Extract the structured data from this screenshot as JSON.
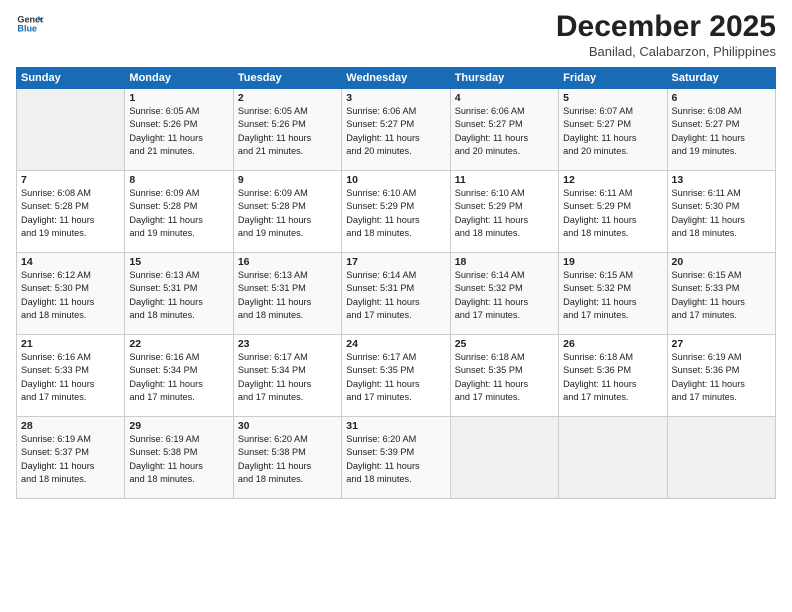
{
  "header": {
    "logo_line1": "General",
    "logo_line2": "Blue",
    "month": "December 2025",
    "location": "Banilad, Calabarzon, Philippines"
  },
  "days_of_week": [
    "Sunday",
    "Monday",
    "Tuesday",
    "Wednesday",
    "Thursday",
    "Friday",
    "Saturday"
  ],
  "weeks": [
    [
      {
        "day": "",
        "info": ""
      },
      {
        "day": "1",
        "info": "Sunrise: 6:05 AM\nSunset: 5:26 PM\nDaylight: 11 hours\nand 21 minutes."
      },
      {
        "day": "2",
        "info": "Sunrise: 6:05 AM\nSunset: 5:26 PM\nDaylight: 11 hours\nand 21 minutes."
      },
      {
        "day": "3",
        "info": "Sunrise: 6:06 AM\nSunset: 5:27 PM\nDaylight: 11 hours\nand 20 minutes."
      },
      {
        "day": "4",
        "info": "Sunrise: 6:06 AM\nSunset: 5:27 PM\nDaylight: 11 hours\nand 20 minutes."
      },
      {
        "day": "5",
        "info": "Sunrise: 6:07 AM\nSunset: 5:27 PM\nDaylight: 11 hours\nand 20 minutes."
      },
      {
        "day": "6",
        "info": "Sunrise: 6:08 AM\nSunset: 5:27 PM\nDaylight: 11 hours\nand 19 minutes."
      }
    ],
    [
      {
        "day": "7",
        "info": "Sunrise: 6:08 AM\nSunset: 5:28 PM\nDaylight: 11 hours\nand 19 minutes."
      },
      {
        "day": "8",
        "info": "Sunrise: 6:09 AM\nSunset: 5:28 PM\nDaylight: 11 hours\nand 19 minutes."
      },
      {
        "day": "9",
        "info": "Sunrise: 6:09 AM\nSunset: 5:28 PM\nDaylight: 11 hours\nand 19 minutes."
      },
      {
        "day": "10",
        "info": "Sunrise: 6:10 AM\nSunset: 5:29 PM\nDaylight: 11 hours\nand 18 minutes."
      },
      {
        "day": "11",
        "info": "Sunrise: 6:10 AM\nSunset: 5:29 PM\nDaylight: 11 hours\nand 18 minutes."
      },
      {
        "day": "12",
        "info": "Sunrise: 6:11 AM\nSunset: 5:29 PM\nDaylight: 11 hours\nand 18 minutes."
      },
      {
        "day": "13",
        "info": "Sunrise: 6:11 AM\nSunset: 5:30 PM\nDaylight: 11 hours\nand 18 minutes."
      }
    ],
    [
      {
        "day": "14",
        "info": "Sunrise: 6:12 AM\nSunset: 5:30 PM\nDaylight: 11 hours\nand 18 minutes."
      },
      {
        "day": "15",
        "info": "Sunrise: 6:13 AM\nSunset: 5:31 PM\nDaylight: 11 hours\nand 18 minutes."
      },
      {
        "day": "16",
        "info": "Sunrise: 6:13 AM\nSunset: 5:31 PM\nDaylight: 11 hours\nand 18 minutes."
      },
      {
        "day": "17",
        "info": "Sunrise: 6:14 AM\nSunset: 5:31 PM\nDaylight: 11 hours\nand 17 minutes."
      },
      {
        "day": "18",
        "info": "Sunrise: 6:14 AM\nSunset: 5:32 PM\nDaylight: 11 hours\nand 17 minutes."
      },
      {
        "day": "19",
        "info": "Sunrise: 6:15 AM\nSunset: 5:32 PM\nDaylight: 11 hours\nand 17 minutes."
      },
      {
        "day": "20",
        "info": "Sunrise: 6:15 AM\nSunset: 5:33 PM\nDaylight: 11 hours\nand 17 minutes."
      }
    ],
    [
      {
        "day": "21",
        "info": "Sunrise: 6:16 AM\nSunset: 5:33 PM\nDaylight: 11 hours\nand 17 minutes."
      },
      {
        "day": "22",
        "info": "Sunrise: 6:16 AM\nSunset: 5:34 PM\nDaylight: 11 hours\nand 17 minutes."
      },
      {
        "day": "23",
        "info": "Sunrise: 6:17 AM\nSunset: 5:34 PM\nDaylight: 11 hours\nand 17 minutes."
      },
      {
        "day": "24",
        "info": "Sunrise: 6:17 AM\nSunset: 5:35 PM\nDaylight: 11 hours\nand 17 minutes."
      },
      {
        "day": "25",
        "info": "Sunrise: 6:18 AM\nSunset: 5:35 PM\nDaylight: 11 hours\nand 17 minutes."
      },
      {
        "day": "26",
        "info": "Sunrise: 6:18 AM\nSunset: 5:36 PM\nDaylight: 11 hours\nand 17 minutes."
      },
      {
        "day": "27",
        "info": "Sunrise: 6:19 AM\nSunset: 5:36 PM\nDaylight: 11 hours\nand 17 minutes."
      }
    ],
    [
      {
        "day": "28",
        "info": "Sunrise: 6:19 AM\nSunset: 5:37 PM\nDaylight: 11 hours\nand 18 minutes."
      },
      {
        "day": "29",
        "info": "Sunrise: 6:19 AM\nSunset: 5:38 PM\nDaylight: 11 hours\nand 18 minutes."
      },
      {
        "day": "30",
        "info": "Sunrise: 6:20 AM\nSunset: 5:38 PM\nDaylight: 11 hours\nand 18 minutes."
      },
      {
        "day": "31",
        "info": "Sunrise: 6:20 AM\nSunset: 5:39 PM\nDaylight: 11 hours\nand 18 minutes."
      },
      {
        "day": "",
        "info": ""
      },
      {
        "day": "",
        "info": ""
      },
      {
        "day": "",
        "info": ""
      }
    ]
  ]
}
